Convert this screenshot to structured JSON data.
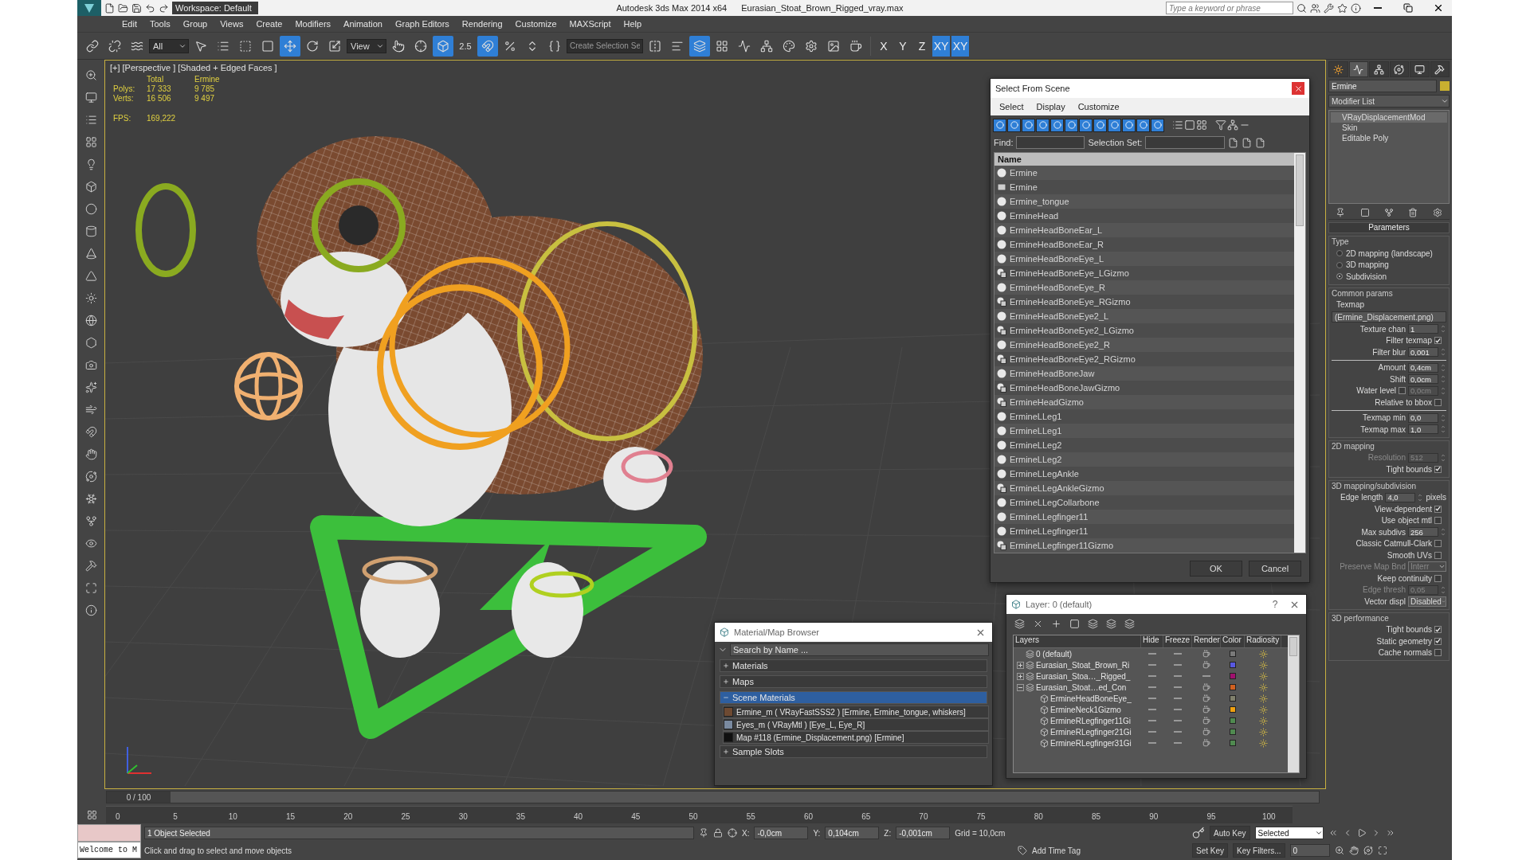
{
  "title_bar": {
    "workspace": "Workspace: Default",
    "app_name": "Autodesk 3ds Max  2014 x64",
    "file_name": "Eurasian_Stoat_Brown_Rigged_vray.max",
    "search": {
      "placeholder": "Type a keyword or phrase"
    }
  },
  "menu": [
    "Edit",
    "Tools",
    "Group",
    "Views",
    "Create",
    "Modifiers",
    "Animation",
    "Graph Editors",
    "Rendering",
    "Customize",
    "MAXScript",
    "Help"
  ],
  "toolbar": {
    "tools": [
      {
        "kind": "icon",
        "selected": false
      },
      {
        "kind": "icon",
        "selected": false
      },
      {
        "kind": "icon",
        "selected": false
      },
      {
        "kind": "dropdown",
        "value": "All"
      },
      {
        "kind": "icon",
        "selected": false
      },
      {
        "kind": "icon",
        "selected": false
      },
      {
        "kind": "icon",
        "selected": false
      },
      {
        "kind": "icon",
        "selected": false
      },
      {
        "kind": "icon",
        "selected": true
      },
      {
        "kind": "icon",
        "selected": false
      },
      {
        "kind": "icon",
        "selected": false
      },
      {
        "kind": "dropdown",
        "value": "View"
      },
      {
        "kind": "icon",
        "selected": false
      },
      {
        "kind": "icon",
        "selected": false
      },
      {
        "kind": "icon",
        "selected": true
      },
      {
        "kind": "snap",
        "label": "2.5",
        "selected": false
      },
      {
        "kind": "icon",
        "selected": true
      },
      {
        "kind": "icon",
        "selected": false
      },
      {
        "kind": "icon",
        "selected": false
      },
      {
        "kind": "icon",
        "selected": false
      },
      {
        "kind": "input",
        "placeholder": "Create Selection Se"
      },
      {
        "kind": "icon",
        "selected": false
      },
      {
        "kind": "icon",
        "selected": false
      },
      {
        "kind": "icon",
        "selected": true
      },
      {
        "kind": "icon",
        "selected": false
      },
      {
        "kind": "icon",
        "selected": false
      },
      {
        "kind": "icon",
        "selected": false
      },
      {
        "kind": "icon",
        "selected": false
      },
      {
        "kind": "icon",
        "selected": false
      },
      {
        "kind": "icon",
        "selected": false
      },
      {
        "kind": "icon",
        "selected": false
      }
    ],
    "axes": [
      {
        "label": "X",
        "selected": false
      },
      {
        "label": "Y",
        "selected": false
      },
      {
        "label": "Z",
        "selected": false
      },
      {
        "label": "XY",
        "selected": true
      },
      {
        "label": "XY",
        "selected": true
      }
    ]
  },
  "viewport": {
    "labels": [
      "[+]",
      "[Perspective ]",
      "[Shaded + Edged Faces ]"
    ],
    "stats": {
      "columns": [
        "Total",
        "Ermine"
      ],
      "rows": [
        {
          "label": "Polys:",
          "values": [
            "17 333",
            "9 785"
          ]
        },
        {
          "label": "Verts:",
          "values": [
            "16 506",
            "9 497"
          ]
        }
      ],
      "fps_label": "FPS:",
      "fps": "169,222"
    }
  },
  "select_dialog": {
    "title": "Select From Scene",
    "menu": [
      "Select",
      "Display",
      "Customize"
    ],
    "display_filters": [
      {
        "on": true
      },
      {
        "on": true
      },
      {
        "on": true
      },
      {
        "on": true
      },
      {
        "on": true
      },
      {
        "on": true
      },
      {
        "on": true
      },
      {
        "on": true
      },
      {
        "on": true
      },
      {
        "on": true
      },
      {
        "on": true
      },
      {
        "on": true
      }
    ],
    "find_label": "Find:",
    "selection_set_label": "Selection Set:",
    "column": "Name",
    "rows": [
      {
        "name": "Ermine",
        "kind": "object"
      },
      {
        "name": "Ermine",
        "kind": "modifier"
      },
      {
        "name": "Ermine_tongue",
        "kind": "object"
      },
      {
        "name": "ErmineHead",
        "kind": "object"
      },
      {
        "name": "ErmineHeadBoneEar_L",
        "kind": "object"
      },
      {
        "name": "ErmineHeadBoneEar_R",
        "kind": "object"
      },
      {
        "name": "ErmineHeadBoneEye_L",
        "kind": "object"
      },
      {
        "name": "ErmineHeadBoneEye_LGizmo",
        "kind": "gizmo"
      },
      {
        "name": "ErmineHeadBoneEye_R",
        "kind": "object"
      },
      {
        "name": "ErmineHeadBoneEye_RGizmo",
        "kind": "gizmo"
      },
      {
        "name": "ErmineHeadBoneEye2_L",
        "kind": "object"
      },
      {
        "name": "ErmineHeadBoneEye2_LGizmo",
        "kind": "gizmo"
      },
      {
        "name": "ErmineHeadBoneEye2_R",
        "kind": "object"
      },
      {
        "name": "ErmineHeadBoneEye2_RGizmo",
        "kind": "gizmo"
      },
      {
        "name": "ErmineHeadBoneJaw",
        "kind": "object"
      },
      {
        "name": "ErmineHeadBoneJawGizmo",
        "kind": "gizmo"
      },
      {
        "name": "ErmineHeadGizmo",
        "kind": "gizmo"
      },
      {
        "name": "ErmineLLeg1",
        "kind": "object"
      },
      {
        "name": "ErmineLLeg1",
        "kind": "object"
      },
      {
        "name": "ErmineLLeg2",
        "kind": "object"
      },
      {
        "name": "ErmineLLeg2",
        "kind": "object"
      },
      {
        "name": "ErmineLLegAnkle",
        "kind": "object"
      },
      {
        "name": "ErmineLLegAnkleGizmo",
        "kind": "gizmo"
      },
      {
        "name": "ErmineLLegCollarbone",
        "kind": "object"
      },
      {
        "name": "ErmineLLegfinger11",
        "kind": "object"
      },
      {
        "name": "ErmineLLegfinger11",
        "kind": "object"
      },
      {
        "name": "ErmineLLegfinger11Gizmo",
        "kind": "gizmo"
      }
    ],
    "buttons": [
      "OK",
      "Cancel"
    ]
  },
  "material_browser": {
    "title": "Material/Map Browser",
    "search": {
      "placeholder": "Search by Name ..."
    },
    "sections": [
      {
        "label": "Materials",
        "expanded": false
      },
      {
        "label": "Maps",
        "expanded": false
      },
      {
        "label": "Scene Materials",
        "expanded": true,
        "items": [
          {
            "label": "Ermine_m  ( VRayFastSSS2 )  [Ermine, Ermine_tongue, whiskers]",
            "color": "#6e4a32"
          },
          {
            "label": "Eyes_m  ( VRayMtl )  [Eye_L, Eye_R]",
            "color": "#7a8aa0"
          },
          {
            "label": "Map #118 (Ermine_Displacement.png)  [Ermine]",
            "color": "#101010"
          }
        ]
      },
      {
        "label": "Sample Slots",
        "expanded": false
      }
    ]
  },
  "layer_dialog": {
    "title": "Layer: 0 (default)",
    "help": "?",
    "columns": [
      "Layers",
      "Hide",
      "Freeze",
      "Render",
      "Color",
      "Radiosity"
    ],
    "rows": [
      {
        "name": "0 (default)",
        "color": "#7a7a7a",
        "renderable": true
      },
      {
        "name": "Eurasian_Stoat_Brown_Ri",
        "color": "#5858e0",
        "renderable": true,
        "expanded": false
      },
      {
        "name": "Eurasian_Stoa…_Rigged_",
        "color": "#a0106e",
        "renderable": false,
        "expanded": false
      },
      {
        "name": "Eurasian_Stoat…ed_Con",
        "color": "#d06020",
        "renderable": true,
        "expanded": true,
        "children": [
          {
            "name": "ErmineHeadBoneEye_",
            "color": "#80806c",
            "renderable": true
          },
          {
            "name": "ErmineNeck1Gizmo",
            "color": "#f0a010",
            "renderable": true
          },
          {
            "name": "ErmineRLegfinger11Gi",
            "color": "#508a50",
            "renderable": true
          },
          {
            "name": "ErmineRLegfinger21Gi",
            "color": "#508a50",
            "renderable": true
          },
          {
            "name": "ErmineRLegfinger31Gi",
            "color": "#508a50",
            "renderable": true
          }
        ]
      }
    ]
  },
  "command_panel": {
    "tabs": [
      {
        "selected": false
      },
      {
        "selected": true
      },
      {
        "selected": false
      },
      {
        "selected": false
      },
      {
        "selected": false
      },
      {
        "selected": false
      }
    ],
    "object_name": "Ermine",
    "modifier_list": "Modifier List",
    "stack": [
      {
        "label": "VRayDisplacementMod",
        "selected": true
      },
      {
        "label": "Skin",
        "selected": false
      },
      {
        "label": "Editable Poly",
        "selected": false
      }
    ],
    "rollout": "Parameters",
    "groups": [
      {
        "title": "Type",
        "rows": [
          {
            "kind": "radio",
            "label": "2D mapping (landscape)",
            "selected": false
          },
          {
            "kind": "radio",
            "label": "3D mapping",
            "selected": false
          },
          {
            "kind": "radio",
            "label": "Subdivision",
            "selected": true
          }
        ]
      },
      {
        "title": "Common params",
        "rows": [
          {
            "kind": "text",
            "label": "Texmap"
          },
          {
            "kind": "field",
            "value": "(Ermine_Displacement.png)"
          },
          {
            "kind": "spinner",
            "label": "Texture chan",
            "value": "1",
            "disabled": false
          },
          {
            "kind": "check",
            "label": "Filter texmap",
            "checked": true
          },
          {
            "kind": "spinner",
            "label": "Filter blur",
            "value": "0,001",
            "disabled": false
          },
          {
            "kind": "rule"
          },
          {
            "kind": "spinner",
            "label": "Amount",
            "value": "0,4cm",
            "disabled": false
          },
          {
            "kind": "spinner",
            "label": "Shift",
            "value": "0,0cm",
            "disabled": false
          },
          {
            "kind": "check_spinner",
            "label": "Water level",
            "checked": false,
            "value": "0,0cm",
            "disabled": true
          },
          {
            "kind": "check",
            "label": "Relative to bbox",
            "checked": false
          },
          {
            "kind": "rule"
          },
          {
            "kind": "spinner",
            "label": "Texmap min",
            "value": "0,0",
            "disabled": false
          },
          {
            "kind": "spinner",
            "label": "Texmap max",
            "value": "1,0",
            "disabled": false
          }
        ]
      },
      {
        "title": "2D mapping",
        "rows": [
          {
            "kind": "spinner",
            "label": "Resolution",
            "value": "512",
            "disabled": true
          },
          {
            "kind": "check",
            "label": "Tight bounds",
            "checked": true
          }
        ]
      },
      {
        "title": "3D mapping/subdivision",
        "rows": [
          {
            "kind": "spinner",
            "label": "Edge length",
            "value": "4,0",
            "unit": "pixels",
            "disabled": false
          },
          {
            "kind": "check",
            "label": "View-dependent",
            "checked": true
          },
          {
            "kind": "check",
            "label": "Use object mtl",
            "checked": false
          },
          {
            "kind": "spinner",
            "label": "Max subdivs",
            "value": "256",
            "disabled": false
          },
          {
            "kind": "check",
            "label": "Classic Catmull-Clark",
            "checked": false
          },
          {
            "kind": "check",
            "label": "Smooth UVs",
            "checked": false
          },
          {
            "kind": "dropdown",
            "label": "Preserve Map Bnd",
            "value": "Interr",
            "disabled": true
          },
          {
            "kind": "check",
            "label": "Keep continuity",
            "checked": false
          },
          {
            "kind": "spinner",
            "label": "Edge thresh",
            "value": "0,05",
            "disabled": true
          },
          {
            "kind": "dropdown",
            "label": "Vector displ",
            "value": "Disabled",
            "disabled": false
          }
        ]
      },
      {
        "title": "3D performance",
        "rows": [
          {
            "kind": "check",
            "label": "Tight bounds",
            "checked": true
          },
          {
            "kind": "check",
            "label": "Static geometry",
            "checked": true
          },
          {
            "kind": "check",
            "label": "Cache normals",
            "checked": false
          }
        ]
      }
    ]
  },
  "timeline": {
    "frame": "0 / 100",
    "level": 0,
    "ticks": [
      "0",
      "5",
      "10",
      "15",
      "20",
      "25",
      "30",
      "35",
      "40",
      "45",
      "50",
      "55",
      "60",
      "65",
      "70",
      "75",
      "80",
      "85",
      "90",
      "95",
      "100"
    ]
  },
  "status_bar": {
    "listener": "Welcome to M",
    "selection": "1 Object Selected",
    "prompt": "Click and drag to select and move objects",
    "coords": [
      {
        "axis": "X:",
        "value": "-0,0cm"
      },
      {
        "axis": "Y:",
        "value": "0,104cm"
      },
      {
        "axis": "Z:",
        "value": "-0,001cm"
      }
    ],
    "grid": "Grid = 10,0cm",
    "add_time_tag": "Add Time Tag",
    "auto_key": "Auto Key",
    "set_key": "Set Key",
    "key_mode": "Selected",
    "key_filters": "Key Filters...",
    "current_frame": "0"
  }
}
